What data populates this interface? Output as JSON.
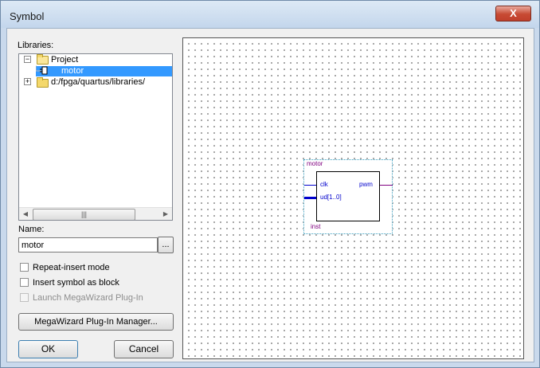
{
  "window": {
    "title": "Symbol",
    "close_label": "X"
  },
  "libraries": {
    "label": "Libraries:",
    "tree": [
      {
        "label": "Project",
        "expander": "−",
        "icon": "folder-open-icon"
      },
      {
        "label": "motor",
        "icon": "symbol-icon",
        "selected": true
      },
      {
        "label": "d:/fpga/quartus/libraries/",
        "expander": "+",
        "icon": "folder-icon"
      }
    ],
    "scroll_left": "◀",
    "scroll_right": "▶",
    "scroll_grip": "|||"
  },
  "name": {
    "label": "Name:",
    "value": "motor",
    "browse_label": "..."
  },
  "options": {
    "repeat_insert": "Repeat-insert mode",
    "as_block": "Insert symbol as block",
    "megawizard_launch": "Launch MegaWizard Plug-In"
  },
  "buttons": {
    "megawizard_manager": "MegaWizard Plug-In Manager...",
    "ok": "OK",
    "cancel": "Cancel"
  },
  "symbol": {
    "name": "motor",
    "instance": "inst",
    "inputs": [
      "clk",
      "ud[1..0]"
    ],
    "outputs": [
      "pwm"
    ]
  },
  "colors": {
    "selection": "#3399ff",
    "pin_input": "#0000cc",
    "pin_output": "#800080"
  }
}
